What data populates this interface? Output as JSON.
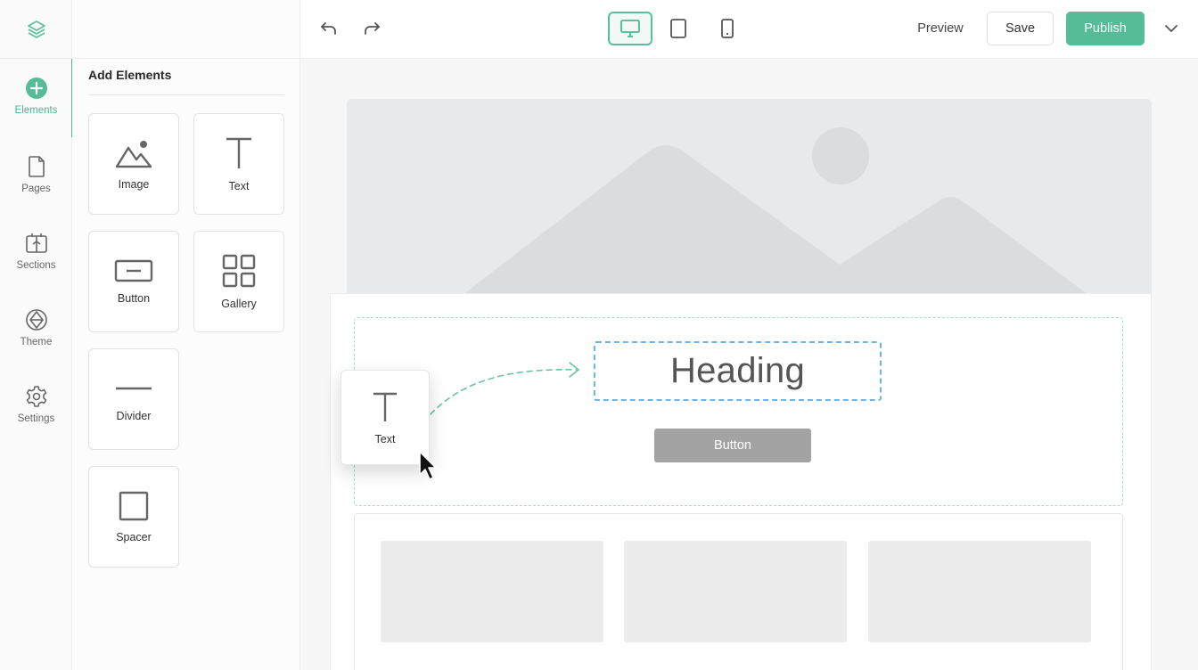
{
  "rail": {
    "items": [
      {
        "label": "Elements",
        "icon": "plus-circle-icon",
        "active": true
      },
      {
        "label": "Pages",
        "icon": "page-icon"
      },
      {
        "label": "Sections",
        "icon": "sections-icon"
      },
      {
        "label": "Theme",
        "icon": "theme-icon"
      },
      {
        "label": "Settings",
        "icon": "gear-icon"
      }
    ]
  },
  "panel": {
    "title": "Add Elements",
    "elements": [
      {
        "label": "Image",
        "icon": "image-icon"
      },
      {
        "label": "Text",
        "icon": "text-icon"
      },
      {
        "label": "Button",
        "icon": "button-icon"
      },
      {
        "label": "Gallery",
        "icon": "grid-icon"
      },
      {
        "label": "Divider",
        "icon": "divider-icon"
      },
      {
        "label": "Spacer",
        "icon": "square-icon"
      }
    ]
  },
  "toolbar": {
    "preview": "Preview",
    "save": "Save",
    "publish": "Publish"
  },
  "canvas": {
    "heading": "Heading",
    "button": "Button"
  },
  "drag": {
    "label": "Text"
  },
  "colors": {
    "accent": "#56bc98",
    "selection": "#6fb4e4"
  }
}
